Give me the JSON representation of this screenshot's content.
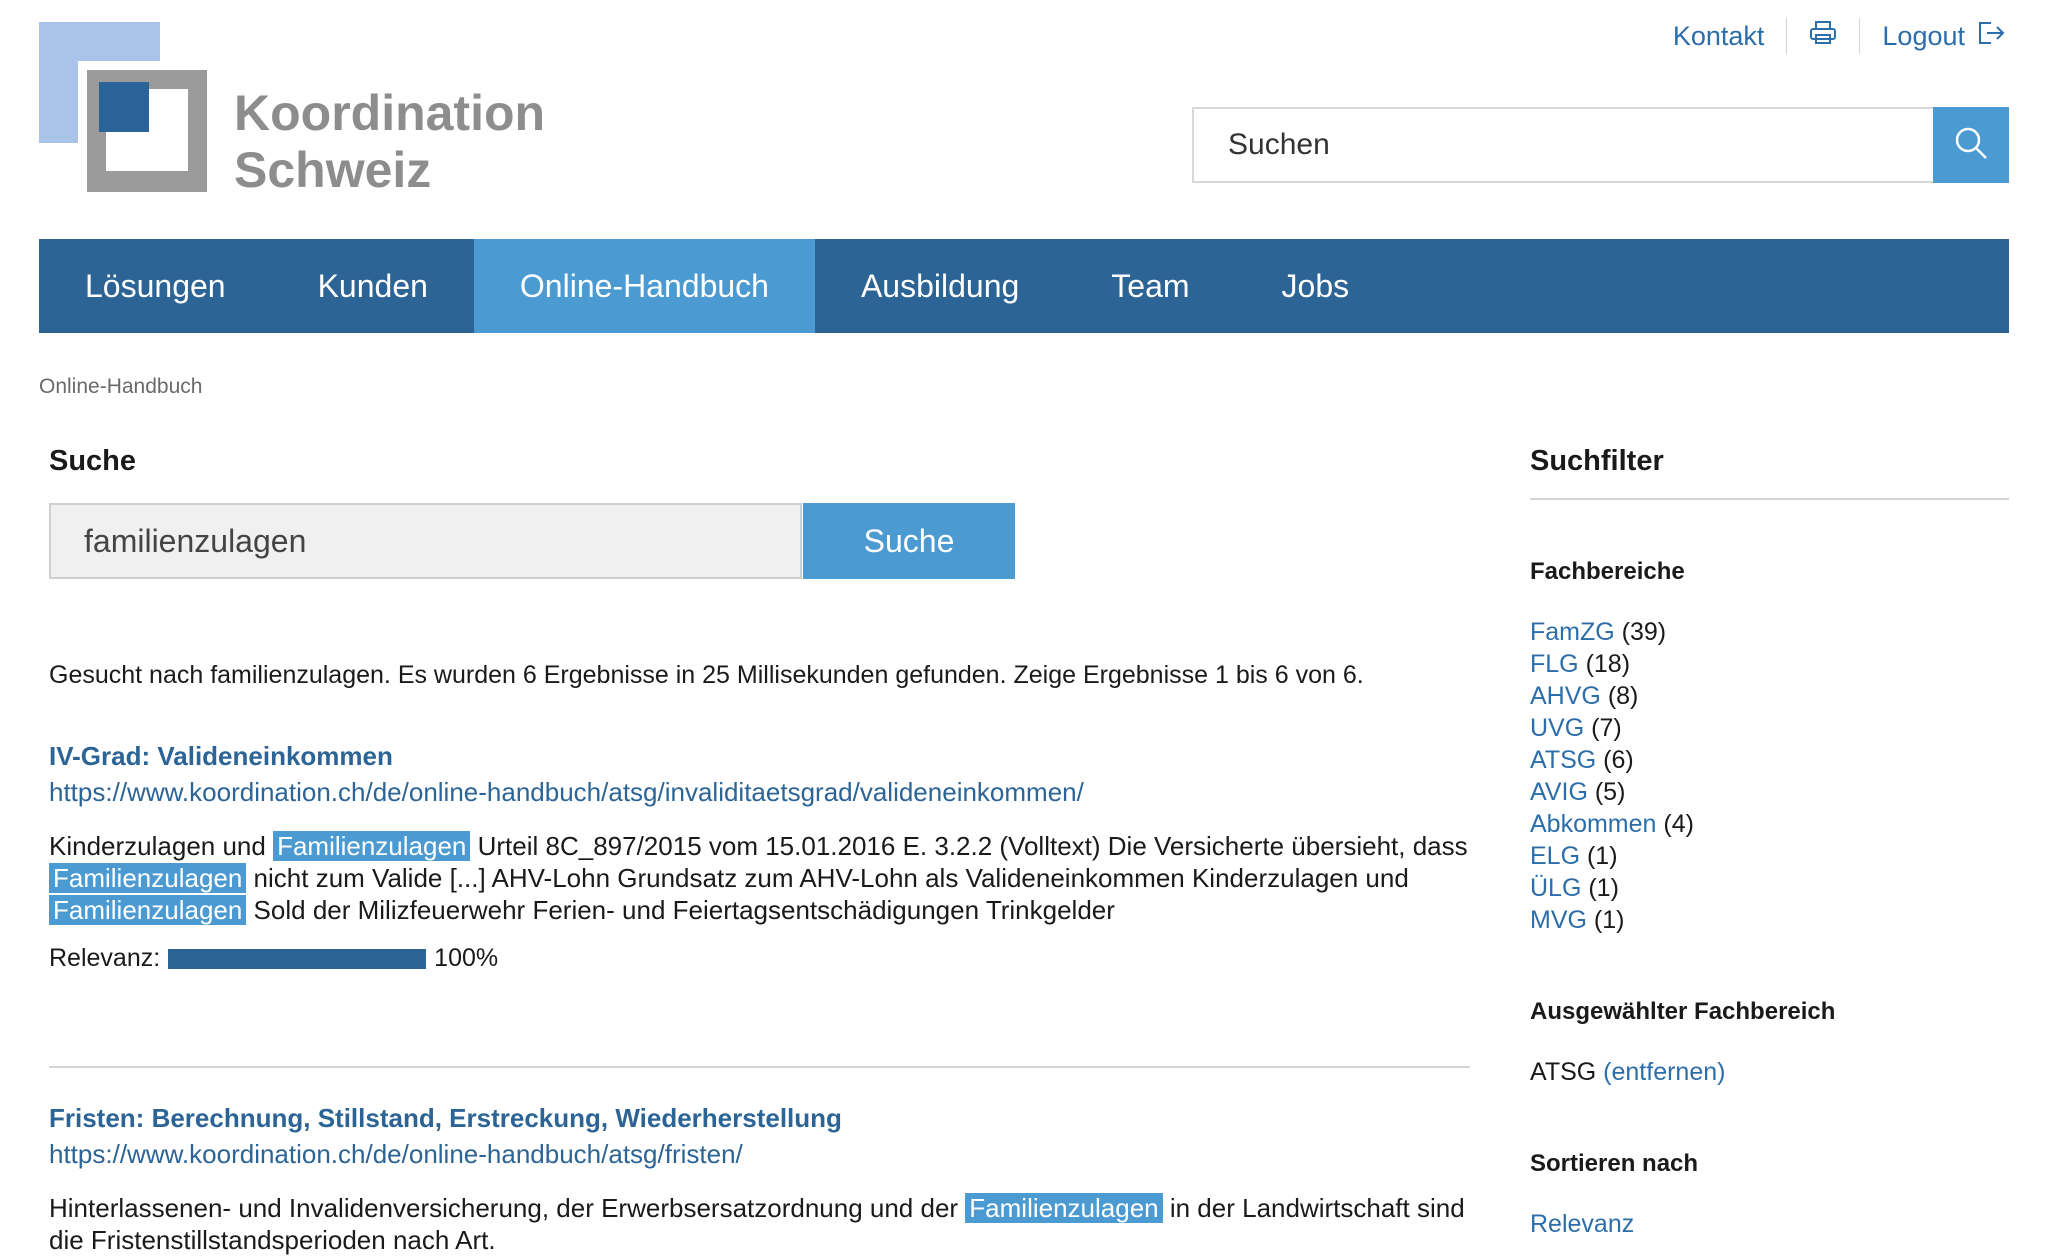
{
  "logo": {
    "line1": "Koordination",
    "line2": "Schweiz"
  },
  "toplinks": {
    "kontakt": "Kontakt",
    "logout": "Logout"
  },
  "search_top": {
    "placeholder": "Suchen"
  },
  "nav": [
    "Lösungen",
    "Kunden",
    "Online-Handbuch",
    "Ausbildung",
    "Team",
    "Jobs"
  ],
  "nav_active": "Online-Handbuch",
  "breadcrumb": "Online-Handbuch",
  "search": {
    "heading": "Suche",
    "query": "familienzulagen",
    "button": "Suche",
    "summary": "Gesucht nach familienzulagen. Es wurden 6 Ergebnisse in 25 Millisekunden gefunden. Zeige Ergebnisse 1 bis 6 von 6."
  },
  "results": [
    {
      "title": "IV-Grad: Valideneinkommen",
      "url": "https://www.koordination.ch/de/online-handbuch/atsg/invaliditaetsgrad/valideneinkommen/",
      "snippet": {
        "t1": "Kinderzulagen und ",
        "h1": "Familienzulagen",
        "t2": " Urteil 8C_897/2015 vom 15.01.2016 E. 3.2.2 (Volltext) Die Versicherte übersieht, dass ",
        "h2": "Familienzulagen",
        "t3": " nicht zum Valide [...] AHV-Lohn Grundsatz zum AHV-Lohn als Valideneinkommen Kinderzulagen und ",
        "h3": "Familienzulagen",
        "t4": " Sold der Milizfeuerwehr Ferien- und Feiertagsentschädigungen Trinkgelder"
      },
      "relevance_label": "Relevanz:",
      "relevance": 100,
      "relevance_text": "100%"
    },
    {
      "title": "Fristen: Berechnung, Stillstand, Erstreckung, Wiederherstellung",
      "url": "https://www.koordination.ch/de/online-handbuch/atsg/fristen/",
      "snippet": {
        "t1": "Hinterlassenen- und Invalidenversicherung, der Erwerbsersatzordnung und der ",
        "h1": "Familienzulagen",
        "t2": " in der Landwirtschaft sind die Fristenstillstandsperioden nach Art."
      }
    }
  ],
  "sidebar": {
    "heading": "Suchfilter",
    "fachbereiche_heading": "Fachbereiche",
    "fachbereiche": [
      {
        "name": "FamZG",
        "count": "(39)"
      },
      {
        "name": "FLG",
        "count": "(18)"
      },
      {
        "name": "AHVG",
        "count": "(8)"
      },
      {
        "name": "UVG",
        "count": "(7)"
      },
      {
        "name": "ATSG",
        "count": "(6)"
      },
      {
        "name": "AVIG",
        "count": "(5)"
      },
      {
        "name": "Abkommen",
        "count": "(4)"
      },
      {
        "name": "ELG",
        "count": "(1)"
      },
      {
        "name": "ÜLG",
        "count": "(1)"
      },
      {
        "name": "MVG",
        "count": "(1)"
      }
    ],
    "selected_heading": "Ausgewählter Fachbereich",
    "selected_value": "ATSG",
    "selected_remove": "(entfernen)",
    "sort_heading": "Sortieren nach",
    "sort_option": "Relevanz"
  },
  "colors": {
    "nav": "#2d6496",
    "accent": "#4b9ad2",
    "link": "#2c6eaa"
  }
}
